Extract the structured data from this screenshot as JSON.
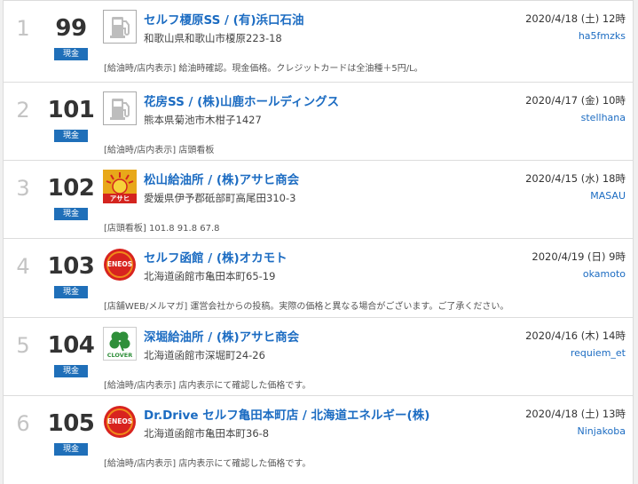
{
  "currency_badge": "現金",
  "rows": [
    {
      "rank": "1",
      "price": "99",
      "logo": "fuel-pump-icon",
      "name": "セルフ榎原SS / (有)浜口石油",
      "address": "和歌山県和歌山市榎原223-18",
      "date": "2020/4/18 (土) 12時",
      "user": "ha5fmzks",
      "note": "[給油時/店内表示] 給油時確認。現金価格。クレジットカードは全油種＋5円/L。"
    },
    {
      "rank": "2",
      "price": "101",
      "logo": "fuel-pump-icon",
      "name": "花房SS / (株)山鹿ホールディングス",
      "address": "熊本県菊池市木柑子1427",
      "date": "2020/4/17 (金) 10時",
      "user": "stellhana",
      "note": "[給油時/店内表示] 店頭看板"
    },
    {
      "rank": "3",
      "price": "102",
      "logo": "asahi-logo",
      "logo_text": "アサヒ",
      "name": "松山給油所 / (株)アサヒ商会",
      "address": "愛媛県伊予郡砥部町高尾田310-3",
      "date": "2020/4/15 (水) 18時",
      "user": "MASAU",
      "note": "[店頭看板] 101.8 91.8 67.8"
    },
    {
      "rank": "4",
      "price": "103",
      "logo": "eneos-logo",
      "logo_text": "ENEOS",
      "name": "セルフ函館 / (株)オカモト",
      "address": "北海道函館市亀田本町65-19",
      "date": "2020/4/19 (日) 9時",
      "user": "okamoto",
      "note": "[店舗WEB/メルマガ] 運営会社からの投稿。実際の価格と異なる場合がございます。ご了承ください。"
    },
    {
      "rank": "5",
      "price": "104",
      "logo": "clover-logo",
      "logo_text": "CLOVER",
      "name": "深堀給油所 / (株)アサヒ商会",
      "address": "北海道函館市深堀町24-26",
      "date": "2020/4/16 (木) 14時",
      "user": "requiem_et",
      "note": "[給油時/店内表示] 店内表示にて確認した価格です。"
    },
    {
      "rank": "6",
      "price": "105",
      "logo": "eneos-logo",
      "logo_text": "ENEOS",
      "name": "Dr.Drive セルフ亀田本町店 / 北海道エネルギー(株)",
      "address": "北海道函館市亀田本町36-8",
      "date": "2020/4/18 (土) 13時",
      "user": "Ninjakoba",
      "note": "[給油時/店内表示] 店内表示にて確認した価格です。"
    }
  ]
}
